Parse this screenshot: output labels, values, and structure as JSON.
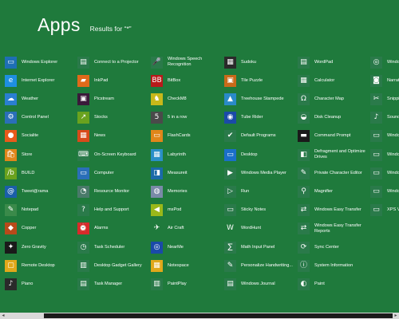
{
  "header": {
    "title": "Apps",
    "subtitle": "Results for “*”"
  },
  "columns": [
    {
      "items": [
        {
          "label": "Windows Explorer",
          "icon": "folder-icon",
          "glyph": "▭",
          "color": "#1e6fb4"
        },
        {
          "label": "Internet Explorer",
          "icon": "ie-icon",
          "glyph": "e",
          "color": "#1e8fe0"
        },
        {
          "label": "Weather",
          "icon": "weather-icon",
          "glyph": "☁",
          "color": "#2a7fd0"
        },
        {
          "label": "Control Panel",
          "icon": "control-panel-icon",
          "glyph": "⚙",
          "color": "#2a6fb8"
        },
        {
          "label": "Socialite",
          "icon": "socialite-icon",
          "glyph": "●",
          "color": "#e85a1a"
        },
        {
          "label": "Store",
          "icon": "store-icon",
          "glyph": "🛍",
          "color": "#e0861a"
        },
        {
          "label": "BUILD",
          "icon": "build-icon",
          "glyph": "/b",
          "color": "#6aa21e"
        },
        {
          "label": "Tweet@rama",
          "icon": "tweetarama-icon",
          "glyph": "@",
          "color": "#1a5fa8"
        },
        {
          "label": "Notepad",
          "icon": "notepad-icon",
          "glyph": "✎",
          "color": "#3a8a4a"
        },
        {
          "label": "Copper",
          "icon": "copper-icon",
          "glyph": "◆",
          "color": "#b84a1a"
        },
        {
          "label": "Zero Gravity",
          "icon": "zero-gravity-icon",
          "glyph": "✦",
          "color": "#1a1a1a"
        },
        {
          "label": "Remote Desktop",
          "icon": "remote-desktop-icon",
          "glyph": "▢",
          "color": "#e0a81a"
        },
        {
          "label": "Piano",
          "icon": "piano-icon",
          "glyph": "♪",
          "color": "#2a2a2a"
        }
      ]
    },
    {
      "items": [
        {
          "label": "Connect to a Projector",
          "icon": "projector-icon",
          "glyph": "▤",
          "color": "#2a7a4a"
        },
        {
          "label": "InkPad",
          "icon": "inkpad-icon",
          "glyph": "▰",
          "color": "#e06a1a"
        },
        {
          "label": "Picstream",
          "icon": "picstream-icon",
          "glyph": "▣",
          "color": "#3a1a3a"
        },
        {
          "label": "Stocks",
          "icon": "stocks-icon",
          "glyph": "↗",
          "color": "#6aa21e"
        },
        {
          "label": "News",
          "icon": "news-icon",
          "glyph": "▦",
          "color": "#d84a1a"
        },
        {
          "label": "On-Screen Keyboard",
          "icon": "keyboard-icon",
          "glyph": "⌨",
          "color": "#2a7a4a"
        },
        {
          "label": "Computer",
          "icon": "computer-icon",
          "glyph": "▭",
          "color": "#2a6fb8"
        },
        {
          "label": "Resource Monitor",
          "icon": "resource-monitor-icon",
          "glyph": "◔",
          "color": "#4a7a6a"
        },
        {
          "label": "Help and Support",
          "icon": "help-icon",
          "glyph": "?",
          "color": "#2a7a4a"
        },
        {
          "label": "Alarms",
          "icon": "alarms-icon",
          "glyph": "⏰",
          "color": "#d82a2a"
        },
        {
          "label": "Task Scheduler",
          "icon": "task-scheduler-icon",
          "glyph": "◷",
          "color": "#2a7a4a"
        },
        {
          "label": "Desktop Gadget Gallery",
          "icon": "gadget-icon",
          "glyph": "▥",
          "color": "#2a7a4a"
        },
        {
          "label": "Task Manager",
          "icon": "task-manager-icon",
          "glyph": "▤",
          "color": "#2a7a4a"
        }
      ]
    },
    {
      "items": [
        {
          "label": "Windows Speech Recognition",
          "icon": "microphone-icon",
          "glyph": "🎤",
          "color": "#2a7a4a"
        },
        {
          "label": "BitBox",
          "icon": "bitbox-icon",
          "glyph": "BB",
          "color": "#b81a1a"
        },
        {
          "label": "CheckM8",
          "icon": "checkm8-icon",
          "glyph": "♞",
          "color": "#c8b81a"
        },
        {
          "label": "5 in a row",
          "icon": "five-in-a-row-icon",
          "glyph": "5",
          "color": "#4a4a4a"
        },
        {
          "label": "FlashCards",
          "icon": "flashcards-icon",
          "glyph": "▭",
          "color": "#e0861a"
        },
        {
          "label": "Labyrinth",
          "icon": "labyrinth-icon",
          "glyph": "▦",
          "color": "#2a8fc8"
        },
        {
          "label": "Measureit",
          "icon": "measureit-icon",
          "glyph": "◨",
          "color": "#1a6aa8"
        },
        {
          "label": "Memories",
          "icon": "memories-icon",
          "glyph": "◍",
          "color": "#7a8aa8"
        },
        {
          "label": "msPod",
          "icon": "mspod-icon",
          "glyph": "◀",
          "color": "#9ab81a"
        },
        {
          "label": "Air Craft",
          "icon": "aircraft-icon",
          "glyph": "✈",
          "color": "#1f7a3c"
        },
        {
          "label": "NearMe",
          "icon": "nearme-icon",
          "glyph": "◎",
          "color": "#1a4aa8"
        },
        {
          "label": "Notespace",
          "icon": "notespace-icon",
          "glyph": "▦",
          "color": "#e0a81a"
        },
        {
          "label": "PaintPlay",
          "icon": "paintplay-icon",
          "glyph": "▥",
          "color": "#2a7a4a"
        }
      ]
    },
    {
      "items": [
        {
          "label": "Sudoku",
          "icon": "sudoku-icon",
          "glyph": "▦",
          "color": "#2a2a2a"
        },
        {
          "label": "Tile Puzzle",
          "icon": "tile-puzzle-icon",
          "glyph": "▣",
          "color": "#c86a1a"
        },
        {
          "label": "Treehouse Stampede",
          "icon": "treehouse-icon",
          "glyph": "▲",
          "color": "#2a8ac8"
        },
        {
          "label": "Tube Rider",
          "icon": "tube-rider-icon",
          "glyph": "◉",
          "color": "#1a4aa8"
        },
        {
          "label": "Default Programs",
          "icon": "default-programs-icon",
          "glyph": "✔",
          "color": "#2a7a4a"
        },
        {
          "label": "Desktop",
          "icon": "desktop-icon",
          "glyph": "▭",
          "color": "#1a6fc8"
        },
        {
          "label": "Windows Media Player",
          "icon": "media-player-icon",
          "glyph": "▶",
          "color": "#2a7a4a"
        },
        {
          "label": "Run",
          "icon": "run-icon",
          "glyph": "▷",
          "color": "#2a7a4a"
        },
        {
          "label": "Sticky Notes",
          "icon": "sticky-notes-icon",
          "glyph": "▭",
          "color": "#2a7a4a"
        },
        {
          "label": "WordHunt",
          "icon": "wordhunt-icon",
          "glyph": "W",
          "color": "#1f7a3c"
        },
        {
          "label": "Math Input Panel",
          "icon": "math-input-icon",
          "glyph": "∑",
          "color": "#2a7a4a"
        },
        {
          "label": "Personalize Handwriting...",
          "icon": "handwriting-icon",
          "glyph": "✎",
          "color": "#2a7a4a"
        },
        {
          "label": "Windows Journal",
          "icon": "journal-icon",
          "glyph": "▤",
          "color": "#2a7a4a"
        }
      ]
    },
    {
      "items": [
        {
          "label": "WordPad",
          "icon": "wordpad-icon",
          "glyph": "▤",
          "color": "#2a7a4a"
        },
        {
          "label": "Calculator",
          "icon": "calculator-icon",
          "glyph": "▦",
          "color": "#2a7a4a"
        },
        {
          "label": "Character Map",
          "icon": "character-map-icon",
          "glyph": "Ω",
          "color": "#2a7a4a"
        },
        {
          "label": "Disk Cleanup",
          "icon": "disk-cleanup-icon",
          "glyph": "◒",
          "color": "#2a7a4a"
        },
        {
          "label": "Command Prompt",
          "icon": "command-prompt-icon",
          "glyph": "▬",
          "color": "#1a1a1a"
        },
        {
          "label": "Defragment and Optimize Drives",
          "icon": "defragment-icon",
          "glyph": "◧",
          "color": "#2a7a4a"
        },
        {
          "label": "Private Character Editor",
          "icon": "character-editor-icon",
          "glyph": "✎",
          "color": "#2a7a4a"
        },
        {
          "label": "Magnifier",
          "icon": "magnifier-icon",
          "glyph": "⚲",
          "color": "#2a7a4a"
        },
        {
          "label": "Windows Easy Transfer",
          "icon": "easy-transfer-icon",
          "glyph": "⇄",
          "color": "#2a7a4a"
        },
        {
          "label": "Windows Easy Transfer Reports",
          "icon": "easy-transfer-reports-icon",
          "glyph": "⇄",
          "color": "#2a7a4a"
        },
        {
          "label": "Sync Center",
          "icon": "sync-center-icon",
          "glyph": "⟳",
          "color": "#2a7a4a"
        },
        {
          "label": "System Information",
          "icon": "system-information-icon",
          "glyph": "ⓘ",
          "color": "#2a7a4a"
        },
        {
          "label": "Paint",
          "icon": "paint-icon",
          "glyph": "◐",
          "color": "#2a7a4a"
        }
      ]
    },
    {
      "items": [
        {
          "label": "Windo Assista",
          "icon": "remote-assistance-icon",
          "glyph": "◎",
          "color": "#2a7a4a"
        },
        {
          "label": "Narrat",
          "icon": "narrator-icon",
          "glyph": "◙",
          "color": "#2a7a4a"
        },
        {
          "label": "Snippi",
          "icon": "snipping-icon",
          "glyph": "✂",
          "color": "#2a7a4a"
        },
        {
          "label": "Sound",
          "icon": "sound-icon",
          "glyph": "♪",
          "color": "#2a7a4a"
        },
        {
          "label": "Windo",
          "icon": "windows-app-icon",
          "glyph": "▭",
          "color": "#2a7a4a"
        },
        {
          "label": "Windo",
          "icon": "windows-app-icon",
          "glyph": "▭",
          "color": "#2a7a4a"
        },
        {
          "label": "Windo",
          "icon": "windows-app-icon",
          "glyph": "▭",
          "color": "#2a7a4a"
        },
        {
          "label": "Windo ISE",
          "icon": "powershell-ise-icon",
          "glyph": "▭",
          "color": "#2a7a4a"
        },
        {
          "label": "XPS Vi",
          "icon": "xps-viewer-icon",
          "glyph": "▭",
          "color": "#2a7a4a"
        }
      ]
    }
  ],
  "scrollbar": {
    "left_arrow": "◂",
    "right_arrow": "▸"
  }
}
